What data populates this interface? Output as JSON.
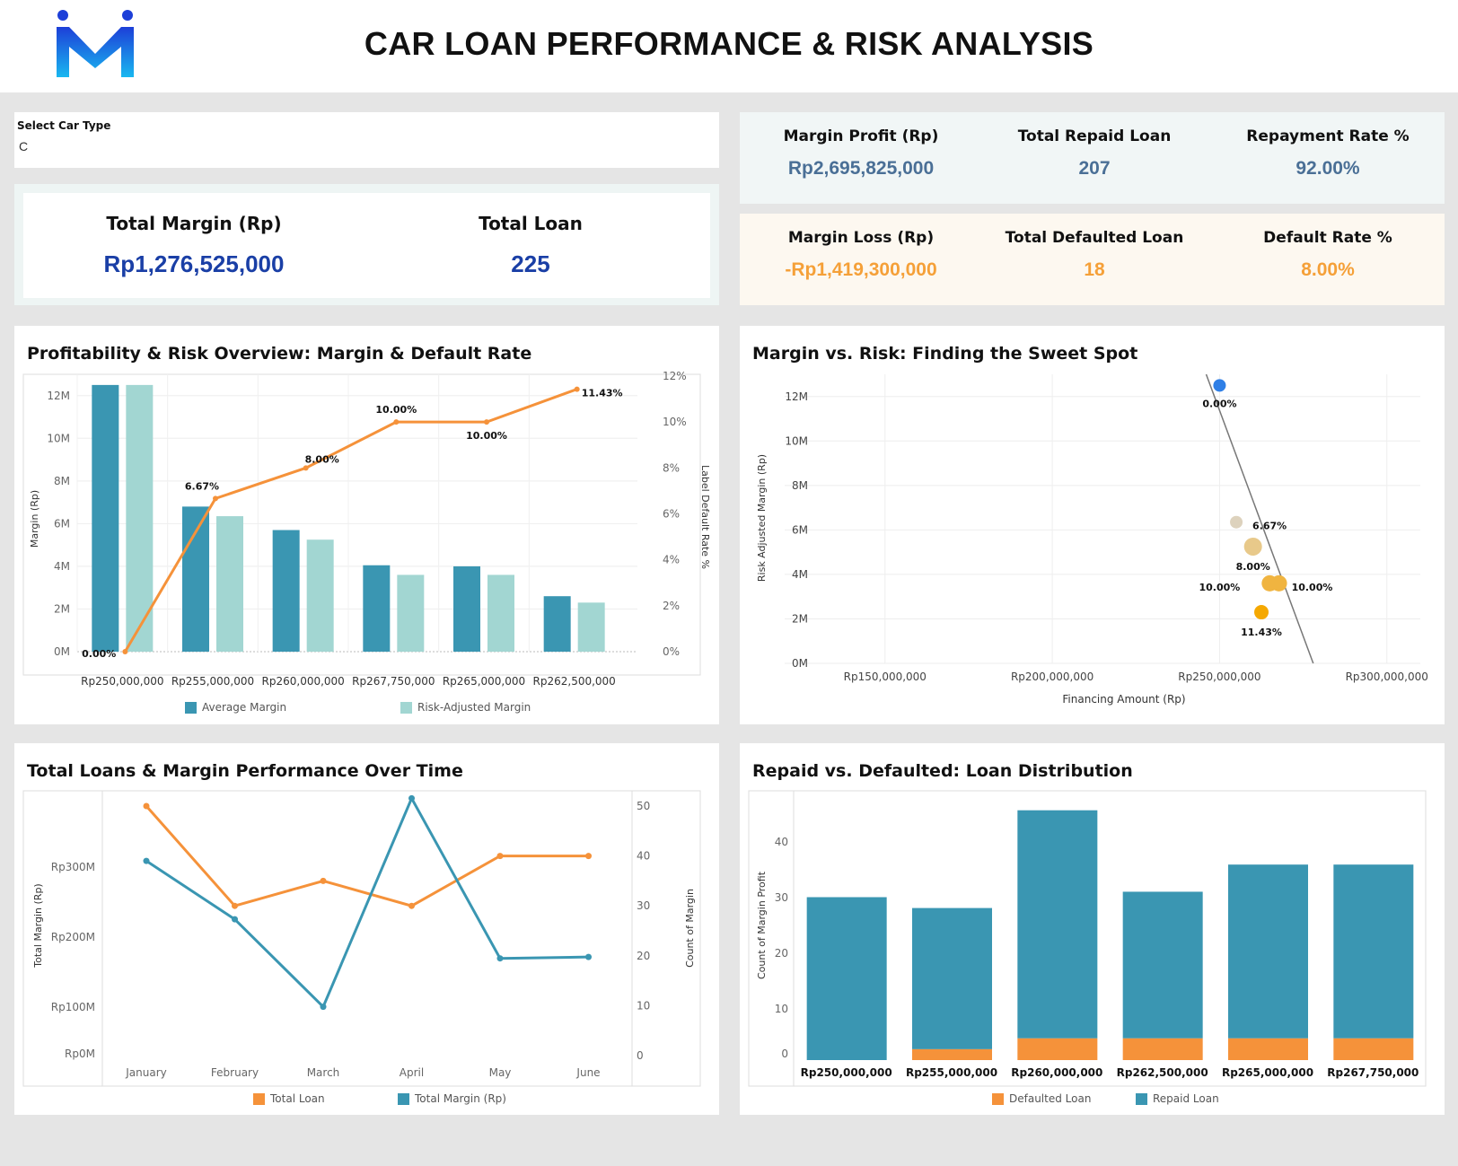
{
  "header": {
    "title": "CAR LOAN PERFORMANCE & RISK ANALYSIS",
    "logo_icon": "m-logo-icon"
  },
  "filter": {
    "label": "Select Car Type",
    "value": "C"
  },
  "summary": {
    "total_margin_label": "Total Margin (Rp)",
    "total_margin_value": "Rp1,276,525,000",
    "total_loan_label": "Total Loan",
    "total_loan_value": "225"
  },
  "profit_kpis": {
    "margin_profit_label": "Margin Profit (Rp)",
    "margin_profit_value": "Rp2,695,825,000",
    "repaid_label": "Total Repaid Loan",
    "repaid_value": "207",
    "repay_rate_label": "Repayment Rate %",
    "repay_rate_value": "92.00%"
  },
  "loss_kpis": {
    "margin_loss_label": "Margin Loss (Rp)",
    "margin_loss_value": "-Rp1,419,300,000",
    "defaulted_label": "Total Defaulted Loan",
    "defaulted_value": "18",
    "default_rate_label": "Default Rate %",
    "default_rate_value": "8.00%"
  },
  "colors": {
    "teal": "#3a96b2",
    "light_teal": "#a2d6d2",
    "orange": "#f5923a",
    "blue_value": "#1a3fa6",
    "kpi_blue": "#4a6f96",
    "kpi_orange": "#f5a038"
  },
  "chart_data": [
    {
      "type": "bar",
      "title": "Profitability & Risk Overview: Margin & Default Rate",
      "ylabel": "Margin (Rp)",
      "y2label": "Label Default Rate %",
      "categories": [
        "Rp250,000,000",
        "Rp255,000,000",
        "Rp260,000,000",
        "Rp267,750,000",
        "Rp265,000,000",
        "Rp262,500,000"
      ],
      "yticks": [
        "0M",
        "2M",
        "4M",
        "6M",
        "8M",
        "10M",
        "12M"
      ],
      "y2ticks": [
        "0%",
        "2%",
        "4%",
        "6%",
        "8%",
        "10%",
        "12%"
      ],
      "ylim": [
        0,
        13
      ],
      "y2lim": [
        0,
        12
      ],
      "series": [
        {
          "name": "Average Margin",
          "values": [
            12.5,
            6.8,
            5.7,
            4.05,
            4.0,
            2.6
          ]
        },
        {
          "name": "Risk-Adjusted Margin",
          "values": [
            12.5,
            6.35,
            5.25,
            3.6,
            3.6,
            2.3
          ]
        },
        {
          "name": "Default Rate",
          "values": [
            0,
            6.67,
            8.0,
            10.0,
            10.0,
            11.43
          ],
          "labels": [
            "0.00%",
            "6.67%",
            "8.00%",
            "10.00%",
            "10.00%",
            "11.43%"
          ]
        }
      ]
    },
    {
      "type": "scatter",
      "title": "Margin vs. Risk: Finding the Sweet Spot",
      "xlabel": "Financing Amount (Rp)",
      "ylabel": "Risk Adjusted Margin (Rp)",
      "xticks": [
        "Rp150,000,000",
        "Rp200,000,000",
        "Rp250,000,000",
        "Rp300,000,000"
      ],
      "yticks": [
        "0M",
        "2M",
        "4M",
        "6M",
        "8M",
        "10M",
        "12M"
      ],
      "points": [
        {
          "x": 250000000,
          "y": 12.5,
          "label": "0.00%",
          "color": "#2f7fe6"
        },
        {
          "x": 255000000,
          "y": 6.35,
          "label": "6.67%",
          "color": "#ddd2bd"
        },
        {
          "x": 260000000,
          "y": 5.25,
          "label": "8.00%",
          "color": "#e8c98a"
        },
        {
          "x": 265000000,
          "y": 3.6,
          "label": "10.00%",
          "color": "#f0b440"
        },
        {
          "x": 267750000,
          "y": 3.6,
          "label": "10.00%",
          "color": "#f0b440"
        },
        {
          "x": 262500000,
          "y": 2.3,
          "label": "11.43%",
          "color": "#f5a800"
        }
      ]
    },
    {
      "type": "line",
      "title": "Total Loans & Margin Performance Over Time",
      "ylabel": "Total Margin (Rp)",
      "y2label": "Count of Margin",
      "categories": [
        "January",
        "February",
        "March",
        "April",
        "May",
        "June"
      ],
      "yticks": [
        "Rp0M",
        "Rp100M",
        "Rp200M",
        "Rp300M"
      ],
      "y2ticks": [
        "0",
        "10",
        "20",
        "30",
        "40",
        "50"
      ],
      "series": [
        {
          "name": "Total Loan",
          "axis": "right",
          "values": [
            50,
            30,
            35,
            30,
            40,
            40
          ]
        },
        {
          "name": "Total Margin (Rp)",
          "axis": "left",
          "values": [
            285,
            203,
            80,
            373,
            148,
            150
          ]
        }
      ]
    },
    {
      "type": "bar",
      "title": "Repaid vs. Defaulted: Loan Distribution",
      "ylabel": "Count of Margin Profit",
      "categories": [
        "Rp250,000,000",
        "Rp255,000,000",
        "Rp260,000,000",
        "Rp262,500,000",
        "Rp265,000,000",
        "Rp267,750,000"
      ],
      "yticks": [
        "0",
        "10",
        "20",
        "30",
        "40"
      ],
      "series": [
        {
          "name": "Defaulted Loan",
          "values": [
            0,
            2,
            4,
            4,
            4,
            4
          ]
        },
        {
          "name": "Repaid Loan",
          "values": [
            30,
            26,
            42,
            27,
            32,
            32
          ]
        }
      ]
    }
  ]
}
